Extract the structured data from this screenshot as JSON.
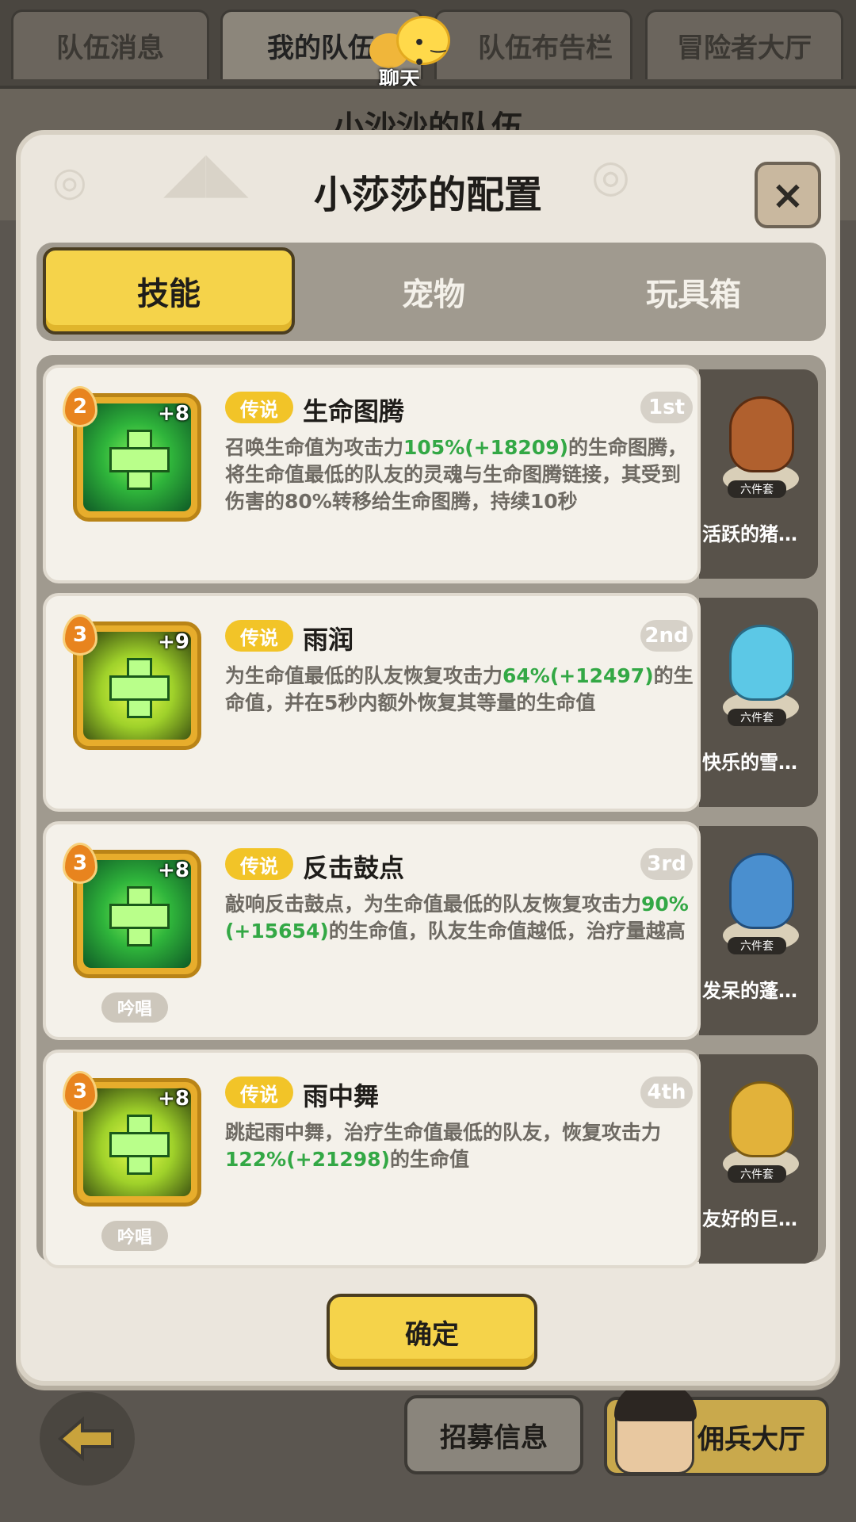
{
  "top_tabs": [
    "队伍消息",
    "我的队伍",
    "队伍布告栏",
    "冒险者大厅"
  ],
  "chat": {
    "label": "聊天"
  },
  "background_title": "小沙沙的队伍",
  "modal": {
    "title": "小莎莎的配置",
    "close_symbol": "×",
    "tabs": [
      "技能",
      "宠物",
      "玩具箱"
    ],
    "active_tab": "技能",
    "confirm_label": "确定"
  },
  "skills": [
    {
      "level": "2",
      "plus": "+8",
      "rarity": "传说",
      "name": "生命图腾",
      "rank": "1st",
      "desc_parts": [
        "召唤生命值为攻击力",
        "105%(+18209)",
        "的生命图腾，将生命值最低的队友的灵魂与生命图腾链接，其受到伤害的80%转移给生命图腾，持续10秒"
      ],
      "chant": "",
      "pet_name": "活跃的猪…",
      "pet_set": "六件套"
    },
    {
      "level": "3",
      "plus": "+9",
      "rarity": "传说",
      "name": "雨润",
      "rank": "2nd",
      "desc_parts": [
        "为生命值最低的队友恢复攻击力",
        "64%(+12497)",
        "的生命值，并在5秒内额外恢复其等量的生命值"
      ],
      "chant": "",
      "pet_name": "快乐的雪…",
      "pet_set": "六件套"
    },
    {
      "level": "3",
      "plus": "+8",
      "rarity": "传说",
      "name": "反击鼓点",
      "rank": "3rd",
      "desc_parts": [
        "敲响反击鼓点，为生命值最低的队友恢复攻击力",
        "90%(+15654)",
        "的生命值，队友生命值越低，治疗量越高"
      ],
      "chant": "吟唱",
      "pet_name": "发呆的蓬…",
      "pet_set": "六件套"
    },
    {
      "level": "3",
      "plus": "+8",
      "rarity": "传说",
      "name": "雨中舞",
      "rank": "4th",
      "desc_parts": [
        "跳起雨中舞，治疗生命值最低的队友，恢复攻击力",
        "122%(+21298)",
        "的生命值"
      ],
      "chant": "吟唱",
      "pet_name": "友好的巨…",
      "pet_set": "六件套"
    }
  ],
  "bottom": {
    "recruit_label": "招募信息",
    "merc_label": "佣兵大厅"
  },
  "colors": {
    "accent": "#f5d34a",
    "highlight": "#33a845",
    "rarity": "#f2c428"
  }
}
